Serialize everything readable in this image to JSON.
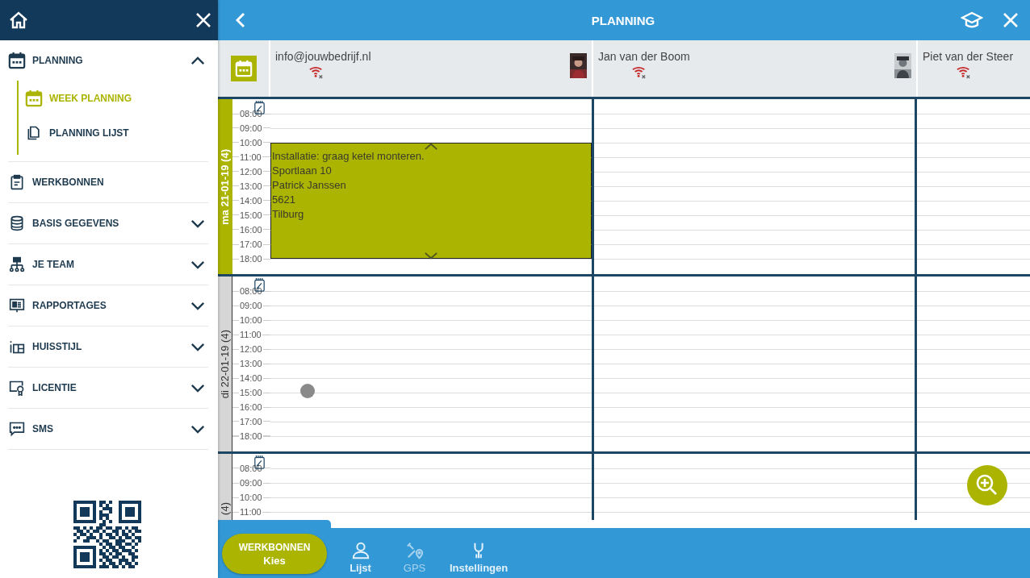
{
  "sidebar": {
    "menu": [
      {
        "label": "PLANNING",
        "kind": "group",
        "expanded": true,
        "children": [
          {
            "label": "WEEK PLANNING",
            "selected": true
          },
          {
            "label": "PLANNING LIJST",
            "selected": false
          }
        ]
      },
      {
        "label": "WERKBONNEN",
        "kind": "link"
      },
      {
        "label": "BASIS GEGEVENS",
        "kind": "group",
        "expanded": false
      },
      {
        "label": "JE TEAM",
        "kind": "group",
        "expanded": false
      },
      {
        "label": "RAPPORTAGES",
        "kind": "group",
        "expanded": false
      },
      {
        "label": "HUISSTIJL",
        "kind": "group",
        "expanded": false
      },
      {
        "label": "LICENTIE",
        "kind": "group",
        "expanded": false
      },
      {
        "label": "SMS",
        "kind": "group",
        "expanded": false
      }
    ]
  },
  "header": {
    "title": "PLANNING"
  },
  "resources": [
    {
      "name": "info@jouwbedrijf.nl",
      "online": false
    },
    {
      "name": "Jan van der Boom",
      "online": false
    },
    {
      "name": "Piet van der Steer",
      "online": false
    }
  ],
  "days": [
    {
      "label": "ma 21-01-19 (4)",
      "selected": true,
      "times": [
        "08:00",
        "09:00",
        "10:00",
        "11:00",
        "12:00",
        "13:00",
        "14:00",
        "15:00",
        "16:00",
        "17:00",
        "18:00"
      ],
      "columns": [
        {
          "slots": [
            {
              "booked": false
            },
            {
              "booked": false
            },
            {
              "booked": true
            },
            {
              "booked": true
            },
            {
              "booked": true
            },
            {
              "booked": true
            },
            {
              "booked": true
            },
            {
              "booked": true
            },
            {
              "booked": true
            },
            {
              "booked": true
            },
            {
              "booked": false
            }
          ],
          "event": {
            "lines": [
              "Installatie: graag ketel monteren.",
              "Sportlaan 10",
              "Patrick Janssen",
              "5621",
              "Tilburg"
            ]
          }
        }
      ]
    },
    {
      "label": "di 22-01-19 (4)",
      "selected": false,
      "times": [
        "08:00",
        "09:00",
        "10:00",
        "11:00",
        "12:00",
        "13:00",
        "14:00",
        "15:00",
        "16:00",
        "17:00",
        "18:00"
      ]
    },
    {
      "label": "(4)",
      "selected": false,
      "times": [
        "08:00",
        "09:00",
        "10:00",
        "11:00"
      ]
    }
  ],
  "bottom_bar": {
    "primary_button": {
      "lines": [
        "WERKBONNEN",
        "Kies"
      ]
    },
    "nav": [
      {
        "label": "Lijst",
        "disabled": false
      },
      {
        "label": "GPS",
        "disabled": true
      },
      {
        "label": "Instellingen",
        "disabled": false
      }
    ]
  }
}
